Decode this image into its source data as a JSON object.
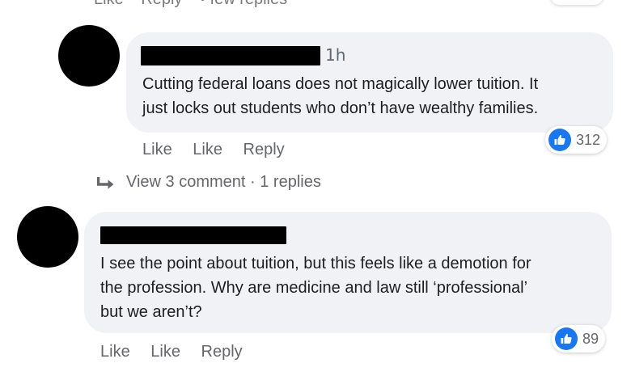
{
  "top_row": {
    "like": "Like",
    "reply": "Reply",
    "more": "• few replies"
  },
  "comments": [
    {
      "timestamp": "1h",
      "text": "Cutting federal loans does not magically lower tuition. It\njust locks out students who don’t have wealthy families.",
      "reaction_count": "312",
      "actions": [
        "Like",
        "Like",
        "Reply"
      ]
    },
    {
      "timestamp": "",
      "text": "I see the point about tuition, but this feels like a demotion for\nthe profession. Why are medicine and law still ‘professional’\nbut we aren’t?",
      "reaction_count": "89",
      "actions": [
        "Like",
        "Like",
        "Reply"
      ]
    }
  ],
  "view_replies": "View 3 comment · 1 replies",
  "icons": {
    "like": "thumbs-up-icon",
    "reply_arrow": "reply-arrow-icon"
  },
  "colors": {
    "bubble": "#f0f2f5",
    "like_blue": "#1877f2",
    "meta_gray": "#65676b"
  }
}
